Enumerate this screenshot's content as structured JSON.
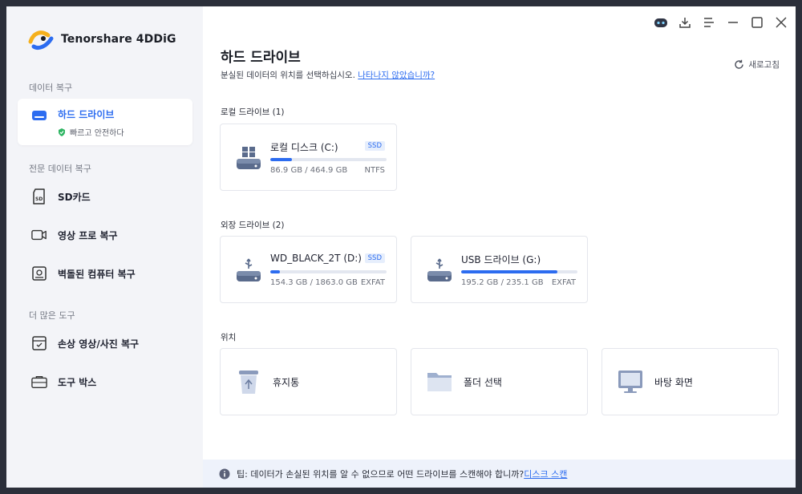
{
  "app": {
    "name": "Tenorshare 4DDiG"
  },
  "colors": {
    "accent": "#2c6cf0",
    "sidebar_bg": "#f3f4f8",
    "success": "#2fb563"
  },
  "sidebar": {
    "section_recovery": "데이터 복구",
    "active_item": {
      "label": "하드 드라이브",
      "sub": "빠르고 안전하다",
      "icon": "hard-drive-icon"
    },
    "section_pro": "전문 데이터 복구",
    "pro_items": [
      {
        "label": "SD카드",
        "icon": "sd-card-icon"
      },
      {
        "label": "영상 프로 복구",
        "icon": "video-icon"
      },
      {
        "label": "벽돌된 컴퓨터 복구",
        "icon": "computer-icon"
      }
    ],
    "section_tools": "더 많은 도구",
    "tool_items": [
      {
        "label": "손상 영상/사진 복구",
        "icon": "photo-repair-icon"
      },
      {
        "label": "도구 박스",
        "icon": "toolbox-icon"
      }
    ]
  },
  "main": {
    "title": "하드 드라이브",
    "subtitle": "분실된 데이터의 위치를 선택하십시오.",
    "subtitle_link": "나타나지 않았습니까?",
    "refresh": "새로고침",
    "local_title": "로컬 드라이브 (1)",
    "local_drives": [
      {
        "name": "로컬 디스크 (C:)",
        "badge": "SSD",
        "size": "86.9 GB / 464.9 GB",
        "fs": "NTFS",
        "used": 0.187
      }
    ],
    "external_title": "외장 드라이브 (2)",
    "external_drives": [
      {
        "name": "WD_BLACK_2T (D:)",
        "badge": "SSD",
        "size": "154.3 GB / 1863.0 GB",
        "fs": "EXFAT",
        "used": 0.083
      },
      {
        "name": "USB 드라이브 (G:)",
        "badge": "",
        "size": "195.2 GB / 235.1 GB",
        "fs": "EXFAT",
        "used": 0.83
      }
    ],
    "location_title": "위치",
    "locations": [
      {
        "label": "휴지통",
        "icon": "recycle-bin-icon"
      },
      {
        "label": "폴더 선택",
        "icon": "folder-icon"
      },
      {
        "label": "바탕 화면",
        "icon": "desktop-icon"
      }
    ]
  },
  "tip": {
    "text": "팁: 데이터가 손실된 위치를 알 수 없으므로 어떤 드라이브를 스캔해야 합니까?",
    "link": "디스크 스캔"
  }
}
